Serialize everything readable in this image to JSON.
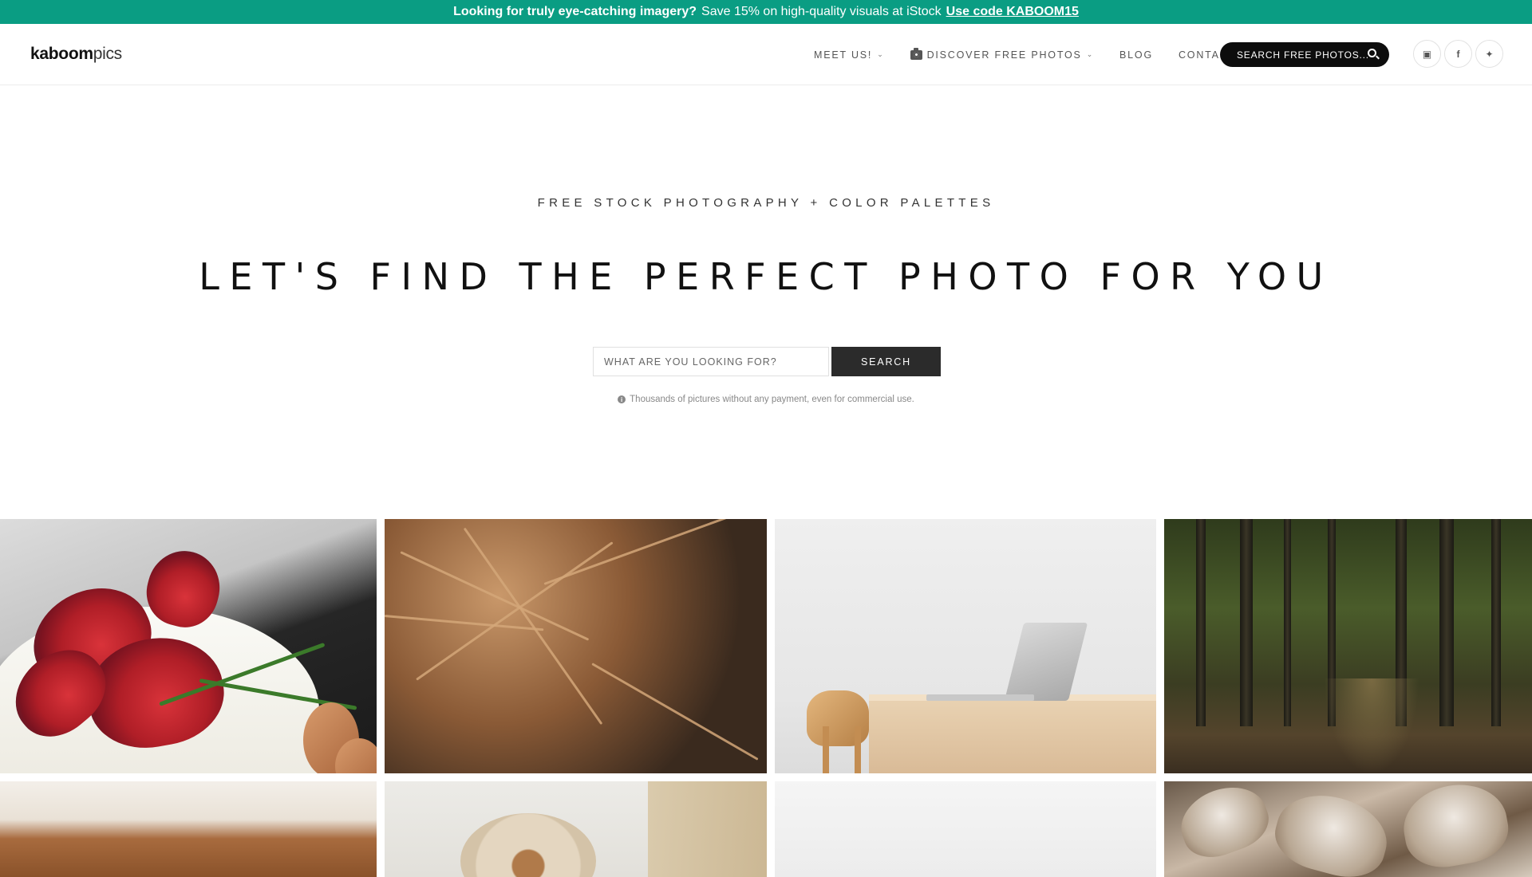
{
  "promo": {
    "lead": "Looking for truly eye-catching imagery?",
    "text": "Save 15% on high-quality visuals at iStock",
    "link": "Use code KABOOM15"
  },
  "header": {
    "logo_bold": "kaboom",
    "logo_light": "pics",
    "nav": [
      {
        "label": "MEET US!",
        "icon": "chevron-down-icon"
      },
      {
        "label": "DISCOVER FREE PHOTOS",
        "icon": "chevron-down-icon"
      },
      {
        "label": "BLOG"
      },
      {
        "label": "CONTACT"
      }
    ],
    "search_pill": "SEARCH FREE PHOTOS...",
    "socials": [
      "instagram-icon",
      "facebook-icon",
      "twitter-icon"
    ]
  },
  "hero": {
    "eyebrow": "FREE STOCK PHOTOGRAPHY + COLOR PALETTES",
    "title": "LET'S FIND THE PERFECT PHOTO FOR YOU",
    "search_placeholder": "WHAT ARE YOU LOOKING FOR?",
    "search_button": "SEARCH",
    "note": "Thousands of pictures without any payment, even for commercial use."
  },
  "colors": {
    "promo_bg": "#0a9d83",
    "search_button_bg": "#2b2b2b",
    "pill_bg": "#0d0d0d"
  }
}
